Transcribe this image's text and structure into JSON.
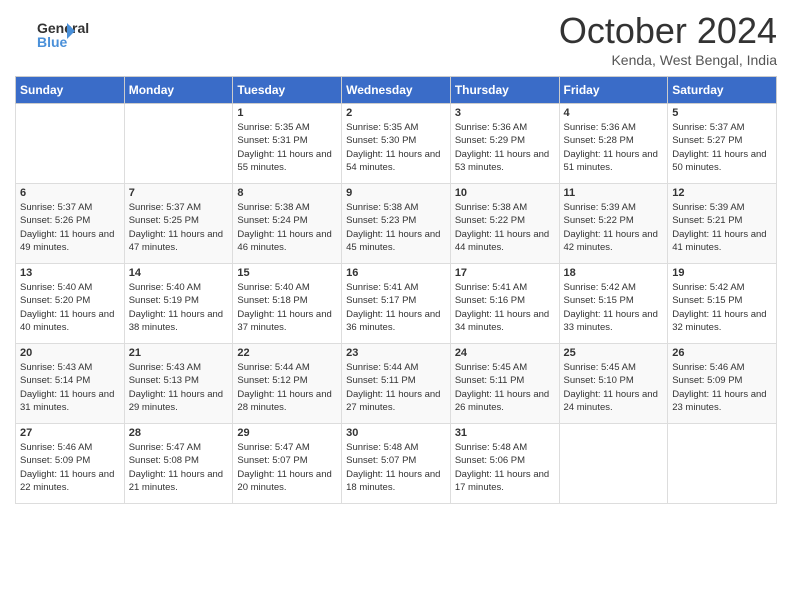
{
  "logo": {
    "line1": "General",
    "line2": "Blue"
  },
  "title": "October 2024",
  "location": "Kenda, West Bengal, India",
  "days_of_week": [
    "Sunday",
    "Monday",
    "Tuesday",
    "Wednesday",
    "Thursday",
    "Friday",
    "Saturday"
  ],
  "weeks": [
    [
      {
        "day": "",
        "info": ""
      },
      {
        "day": "",
        "info": ""
      },
      {
        "day": "1",
        "info": "Sunrise: 5:35 AM\nSunset: 5:31 PM\nDaylight: 11 hours and 55 minutes."
      },
      {
        "day": "2",
        "info": "Sunrise: 5:35 AM\nSunset: 5:30 PM\nDaylight: 11 hours and 54 minutes."
      },
      {
        "day": "3",
        "info": "Sunrise: 5:36 AM\nSunset: 5:29 PM\nDaylight: 11 hours and 53 minutes."
      },
      {
        "day": "4",
        "info": "Sunrise: 5:36 AM\nSunset: 5:28 PM\nDaylight: 11 hours and 51 minutes."
      },
      {
        "day": "5",
        "info": "Sunrise: 5:37 AM\nSunset: 5:27 PM\nDaylight: 11 hours and 50 minutes."
      }
    ],
    [
      {
        "day": "6",
        "info": "Sunrise: 5:37 AM\nSunset: 5:26 PM\nDaylight: 11 hours and 49 minutes."
      },
      {
        "day": "7",
        "info": "Sunrise: 5:37 AM\nSunset: 5:25 PM\nDaylight: 11 hours and 47 minutes."
      },
      {
        "day": "8",
        "info": "Sunrise: 5:38 AM\nSunset: 5:24 PM\nDaylight: 11 hours and 46 minutes."
      },
      {
        "day": "9",
        "info": "Sunrise: 5:38 AM\nSunset: 5:23 PM\nDaylight: 11 hours and 45 minutes."
      },
      {
        "day": "10",
        "info": "Sunrise: 5:38 AM\nSunset: 5:22 PM\nDaylight: 11 hours and 44 minutes."
      },
      {
        "day": "11",
        "info": "Sunrise: 5:39 AM\nSunset: 5:22 PM\nDaylight: 11 hours and 42 minutes."
      },
      {
        "day": "12",
        "info": "Sunrise: 5:39 AM\nSunset: 5:21 PM\nDaylight: 11 hours and 41 minutes."
      }
    ],
    [
      {
        "day": "13",
        "info": "Sunrise: 5:40 AM\nSunset: 5:20 PM\nDaylight: 11 hours and 40 minutes."
      },
      {
        "day": "14",
        "info": "Sunrise: 5:40 AM\nSunset: 5:19 PM\nDaylight: 11 hours and 38 minutes."
      },
      {
        "day": "15",
        "info": "Sunrise: 5:40 AM\nSunset: 5:18 PM\nDaylight: 11 hours and 37 minutes."
      },
      {
        "day": "16",
        "info": "Sunrise: 5:41 AM\nSunset: 5:17 PM\nDaylight: 11 hours and 36 minutes."
      },
      {
        "day": "17",
        "info": "Sunrise: 5:41 AM\nSunset: 5:16 PM\nDaylight: 11 hours and 34 minutes."
      },
      {
        "day": "18",
        "info": "Sunrise: 5:42 AM\nSunset: 5:15 PM\nDaylight: 11 hours and 33 minutes."
      },
      {
        "day": "19",
        "info": "Sunrise: 5:42 AM\nSunset: 5:15 PM\nDaylight: 11 hours and 32 minutes."
      }
    ],
    [
      {
        "day": "20",
        "info": "Sunrise: 5:43 AM\nSunset: 5:14 PM\nDaylight: 11 hours and 31 minutes."
      },
      {
        "day": "21",
        "info": "Sunrise: 5:43 AM\nSunset: 5:13 PM\nDaylight: 11 hours and 29 minutes."
      },
      {
        "day": "22",
        "info": "Sunrise: 5:44 AM\nSunset: 5:12 PM\nDaylight: 11 hours and 28 minutes."
      },
      {
        "day": "23",
        "info": "Sunrise: 5:44 AM\nSunset: 5:11 PM\nDaylight: 11 hours and 27 minutes."
      },
      {
        "day": "24",
        "info": "Sunrise: 5:45 AM\nSunset: 5:11 PM\nDaylight: 11 hours and 26 minutes."
      },
      {
        "day": "25",
        "info": "Sunrise: 5:45 AM\nSunset: 5:10 PM\nDaylight: 11 hours and 24 minutes."
      },
      {
        "day": "26",
        "info": "Sunrise: 5:46 AM\nSunset: 5:09 PM\nDaylight: 11 hours and 23 minutes."
      }
    ],
    [
      {
        "day": "27",
        "info": "Sunrise: 5:46 AM\nSunset: 5:09 PM\nDaylight: 11 hours and 22 minutes."
      },
      {
        "day": "28",
        "info": "Sunrise: 5:47 AM\nSunset: 5:08 PM\nDaylight: 11 hours and 21 minutes."
      },
      {
        "day": "29",
        "info": "Sunrise: 5:47 AM\nSunset: 5:07 PM\nDaylight: 11 hours and 20 minutes."
      },
      {
        "day": "30",
        "info": "Sunrise: 5:48 AM\nSunset: 5:07 PM\nDaylight: 11 hours and 18 minutes."
      },
      {
        "day": "31",
        "info": "Sunrise: 5:48 AM\nSunset: 5:06 PM\nDaylight: 11 hours and 17 minutes."
      },
      {
        "day": "",
        "info": ""
      },
      {
        "day": "",
        "info": ""
      }
    ]
  ]
}
